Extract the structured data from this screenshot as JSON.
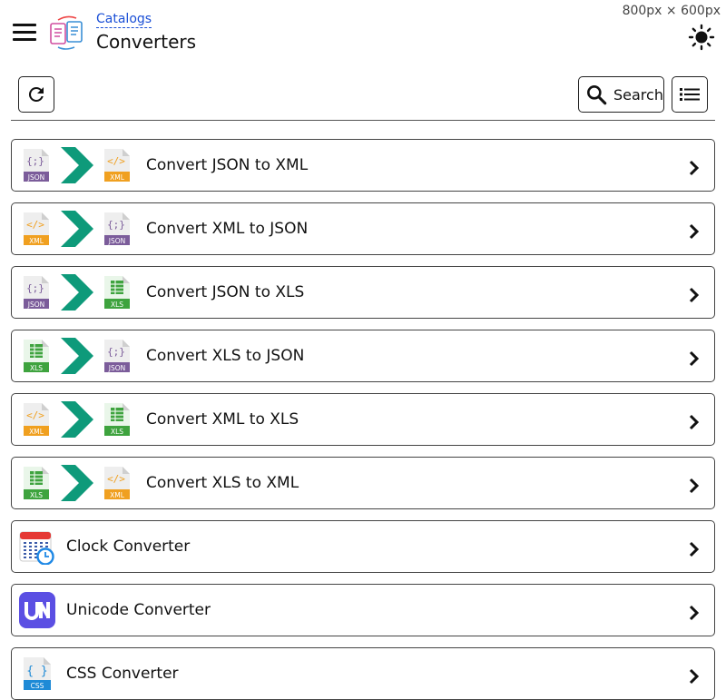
{
  "viewport_label": "800px × 600px",
  "header": {
    "breadcrumb": "Catalogs",
    "title": "Converters"
  },
  "toolbar": {
    "search_label": "Search"
  },
  "colors": {
    "json": "#7b5c9a",
    "xml": "#f0a020",
    "xls": "#3ea33e",
    "arrow": "#0e9a7a",
    "link": "#1a4fd6",
    "unicode": "#5b4fe3",
    "css": "#1e8ad6"
  },
  "items": [
    {
      "label": "Convert JSON to XML",
      "from": "JSON",
      "to": "XML"
    },
    {
      "label": "Convert XML to JSON",
      "from": "XML",
      "to": "JSON"
    },
    {
      "label": "Convert JSON to XLS",
      "from": "JSON",
      "to": "XLS"
    },
    {
      "label": "Convert XLS to JSON",
      "from": "XLS",
      "to": "JSON"
    },
    {
      "label": "Convert XML to XLS",
      "from": "XML",
      "to": "XLS"
    },
    {
      "label": "Convert XLS to XML",
      "from": "XLS",
      "to": "XML"
    },
    {
      "label": "Clock Converter",
      "icon": "calendar-clock-icon"
    },
    {
      "label": "Unicode Converter",
      "icon": "unicode-icon"
    },
    {
      "label": "CSS Converter",
      "icon": "css-file-icon"
    }
  ]
}
